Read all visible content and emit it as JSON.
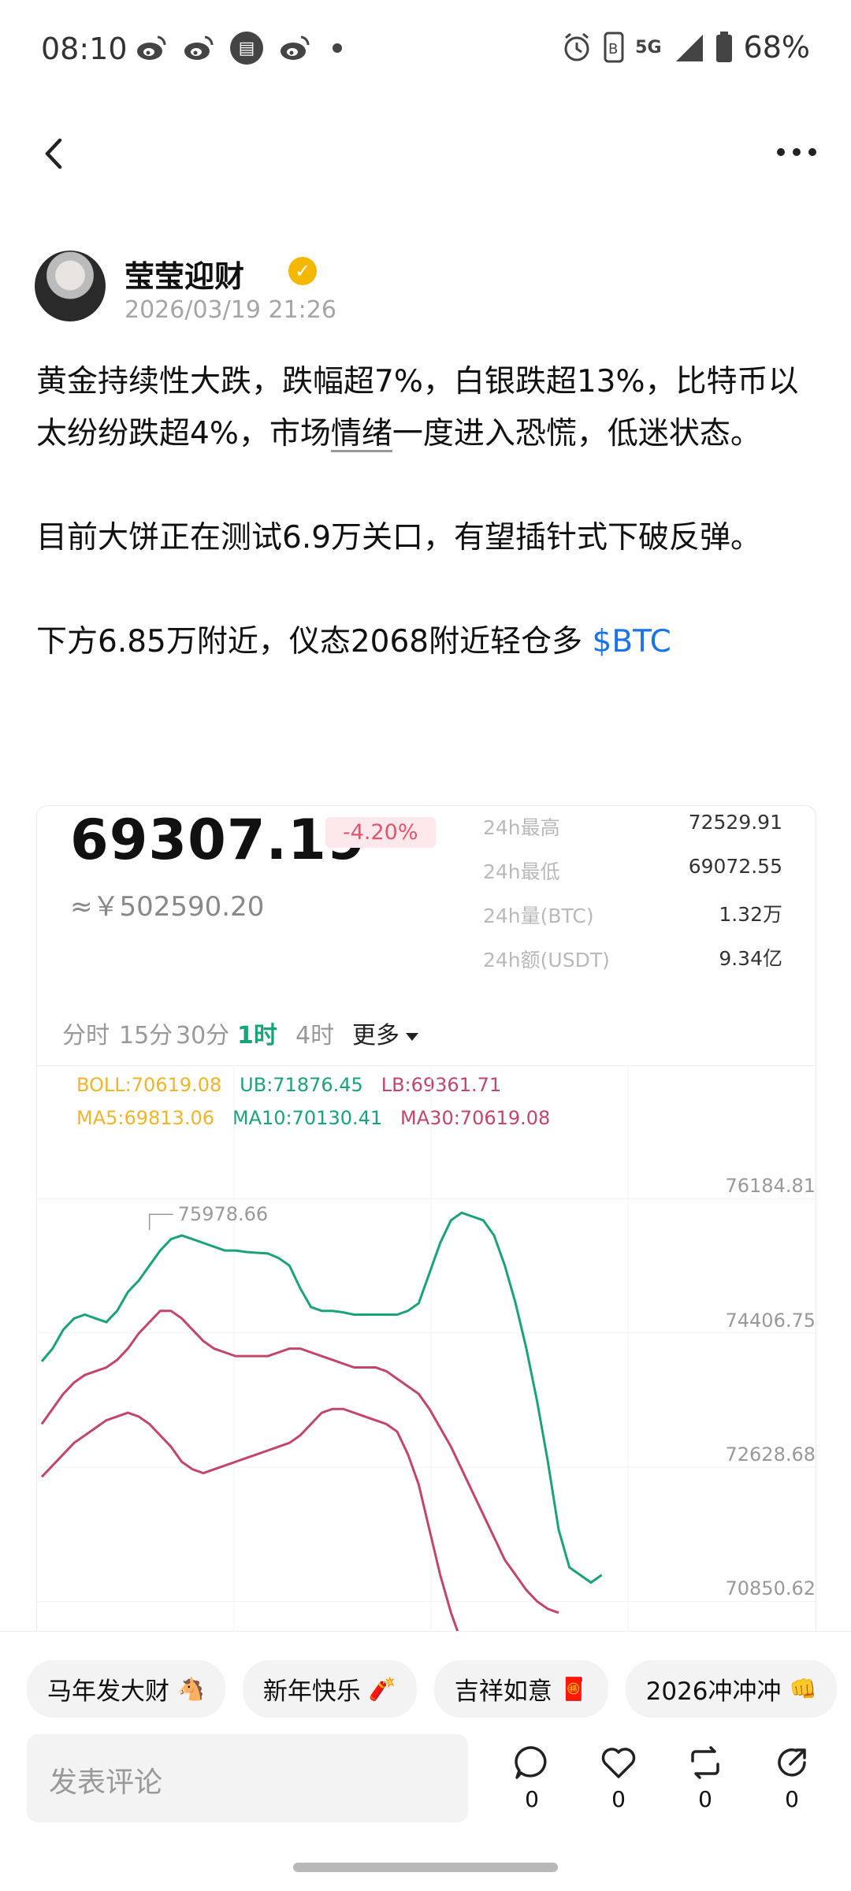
{
  "status_bar": {
    "time": "08:10",
    "battery_text": "68%",
    "network": "5G",
    "icons": [
      "weibo-icon",
      "weibo-icon",
      "calendar-icon",
      "weibo-icon",
      "notification-dot",
      "alarm-icon",
      "nfc-icon",
      "signal-icon",
      "battery-icon"
    ]
  },
  "nav": {
    "back_icon": "chevron-left-icon",
    "more_icon": "more-dots-icon"
  },
  "author": {
    "name": "莹莹迎财",
    "verified_icon": "verified-badge-icon",
    "time": "2026/03/19 21:26"
  },
  "post": {
    "p1_a": "黄金持续性大跌，跌幅超7%，白银跌超13%，比特币以太纷纷跌超4%，市场",
    "p1_u": "情绪",
    "p1_b": "一度进入恐慌，低迷状态。",
    "p2": "目前大饼正在测试6.9万关口，有望插针式下破反弹。",
    "p3": "下方6.85万附近，仪态2068附近轻仓多 ",
    "ticker": "$BTC"
  },
  "market": {
    "price": "69307.19",
    "change": "-4.20%",
    "cny": "≈￥502590.20",
    "stats": [
      {
        "label": "24h最高",
        "value": "72529.91"
      },
      {
        "label": "24h最低",
        "value": "69072.55"
      },
      {
        "label": "24h量(BTC)",
        "value": "1.32万"
      },
      {
        "label": "24h额(USDT)",
        "value": "9.34亿"
      }
    ],
    "tabs": [
      "分时",
      "15分",
      "30分",
      "1时",
      "4时",
      "更多"
    ],
    "active_tab": "1时",
    "colors": {
      "up": "#1fbf8f",
      "down": "#d0506b",
      "ma5": "#f0b429",
      "ma10": "#1aa37a",
      "ma30": "#c2456a",
      "active_tab": "#1aa37a",
      "change_bg": "#fde8ec"
    }
  },
  "chart_data": {
    "type": "line",
    "title": "",
    "xlabel": "",
    "ylabel": "",
    "ylim": [
      69800,
      76900
    ],
    "indicators": {
      "boll": "BOLL:70619.08",
      "ub": "UB:71876.45",
      "lb": "LB:69361.71",
      "ma5": "MA5:69813.06",
      "ma10": "MA10:70130.41",
      "ma30": "MA30:70619.08"
    },
    "y_ticks": [
      "76184.81",
      "74406.75",
      "72628.68",
      "70850.62"
    ],
    "y_tick_values": [
      76184.81,
      74406.75,
      72628.68,
      70850.62
    ],
    "high_label": "75978.66",
    "high_value": 75978.66,
    "x": [
      0,
      1,
      2,
      3,
      4,
      5,
      6,
      7,
      8,
      9,
      10,
      11,
      12,
      13,
      14,
      15,
      16,
      17,
      18,
      19,
      20,
      21,
      22,
      23,
      24,
      25,
      26,
      27,
      28,
      29,
      30,
      31,
      32,
      33,
      34,
      35,
      36,
      37,
      38,
      39,
      40,
      41,
      42,
      43,
      44,
      45,
      46,
      47,
      48,
      49,
      50,
      51,
      52,
      53,
      54,
      55,
      56,
      57,
      58,
      59,
      60
    ],
    "series": [
      {
        "name": "UB",
        "values": [
          74030,
          74200,
          74450,
          74600,
          74650,
          74600,
          74550,
          74700,
          74950,
          75100,
          75300,
          75500,
          75650,
          75700,
          75650,
          75600,
          75550,
          75500,
          75500,
          75480,
          75470,
          75460,
          75400,
          75300,
          75000,
          74750,
          74700,
          74700,
          74680,
          74650,
          74650,
          74650,
          74650,
          74650,
          74700,
          74800,
          75200,
          75600,
          75900,
          76000,
          75950,
          75900,
          75700,
          75300,
          74800,
          74200,
          73500,
          72700,
          71800,
          71300,
          71200,
          71100,
          71200
        ]
      },
      {
        "name": "BOLL",
        "values": [
          73200,
          73400,
          73600,
          73750,
          73850,
          73900,
          73950,
          74050,
          74200,
          74400,
          74550,
          74700,
          74700,
          74600,
          74450,
          74300,
          74200,
          74150,
          74100,
          74100,
          74100,
          74100,
          74150,
          74200,
          74200,
          74150,
          74100,
          74050,
          74000,
          73950,
          73950,
          73950,
          73900,
          73800,
          73700,
          73600,
          73400,
          73150,
          72900,
          72600,
          72300,
          72000,
          71700,
          71400,
          71200,
          71000,
          70850,
          70750,
          70700
        ]
      },
      {
        "name": "LB",
        "values": [
          72500,
          72650,
          72800,
          72950,
          73050,
          73150,
          73250,
          73300,
          73350,
          73300,
          73200,
          73050,
          72900,
          72700,
          72600,
          72550,
          72600,
          72650,
          72700,
          72750,
          72800,
          72850,
          72900,
          72950,
          73050,
          73200,
          73350,
          73400,
          73400,
          73350,
          73300,
          73250,
          73200,
          73100,
          72800,
          72400,
          71800,
          71200,
          70700,
          70300,
          70100
        ]
      }
    ]
  },
  "chips": [
    {
      "text": "马年发大财",
      "emoji": "🐴"
    },
    {
      "text": "新年快乐",
      "emoji": "🧨"
    },
    {
      "text": "吉祥如意",
      "emoji": "🧧"
    },
    {
      "text": "2026冲冲冲",
      "emoji": "👊"
    }
  ],
  "comment": {
    "placeholder": "发表评论"
  },
  "actions": [
    {
      "icon": "comment-icon",
      "count": "0"
    },
    {
      "icon": "heart-icon",
      "count": "0"
    },
    {
      "icon": "repost-icon",
      "count": "0"
    },
    {
      "icon": "share-icon",
      "count": "0"
    }
  ]
}
